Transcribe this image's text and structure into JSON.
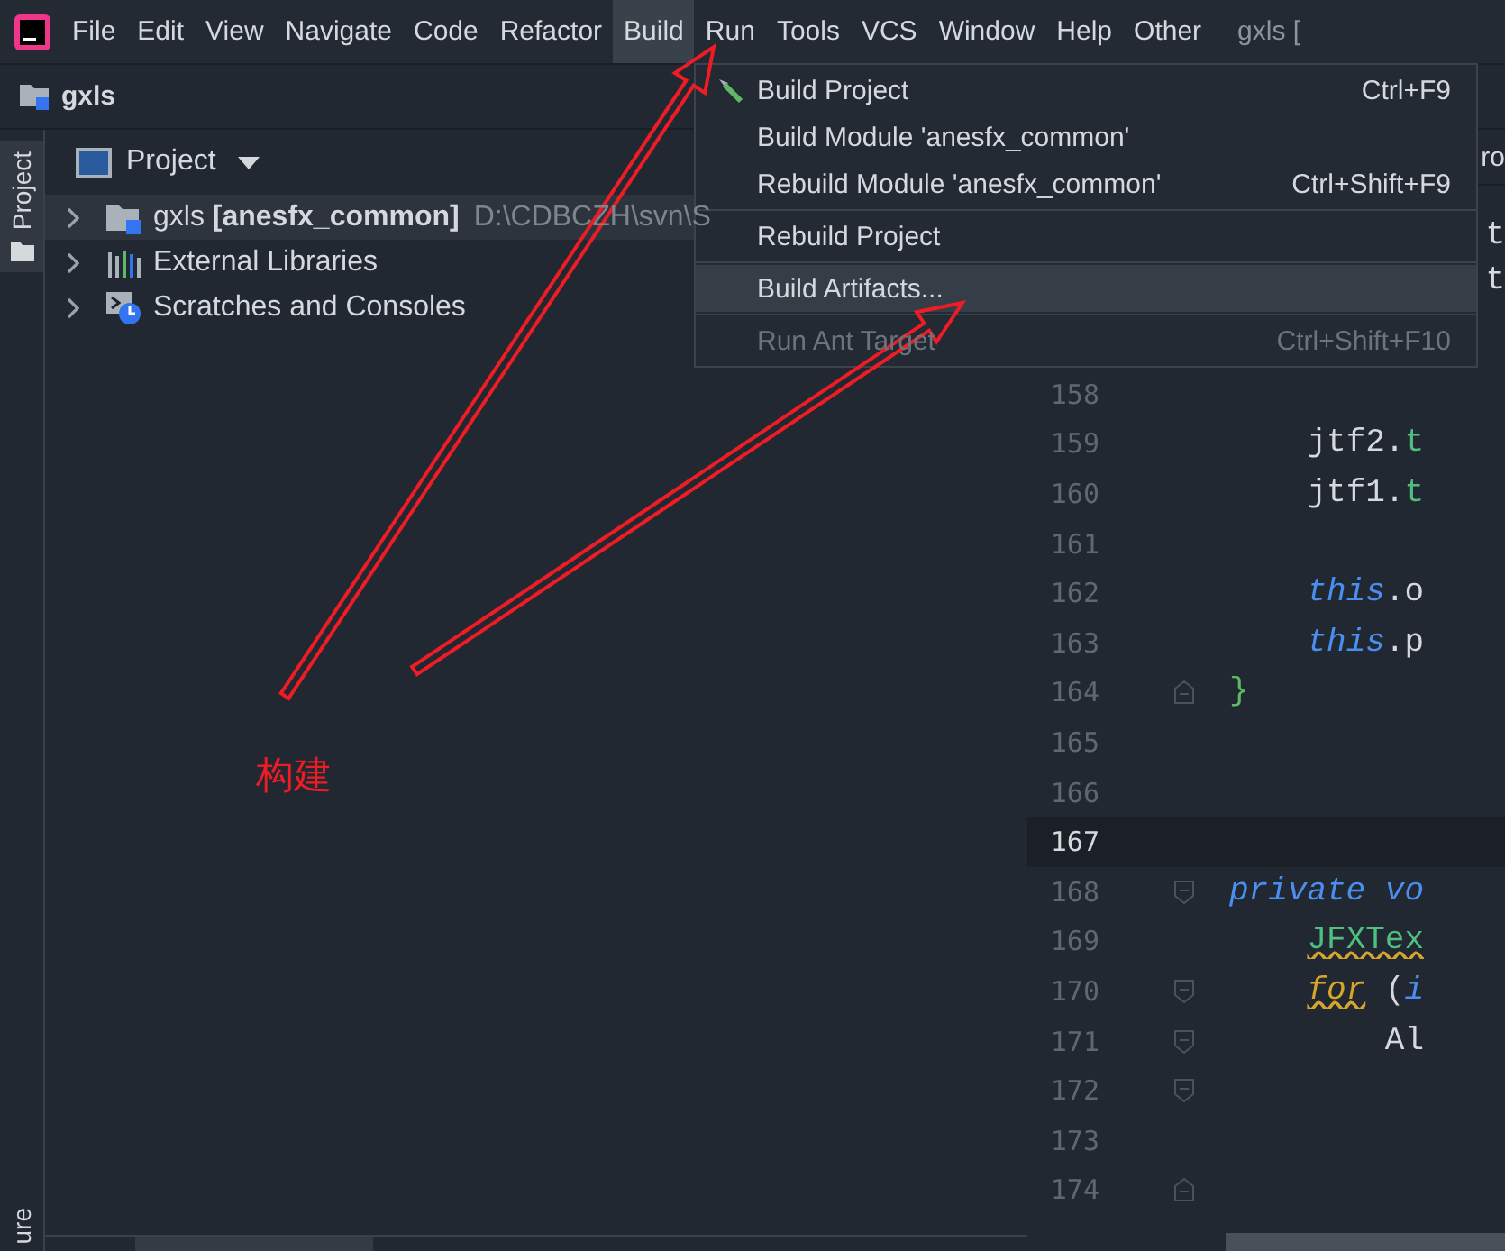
{
  "menu_bar": {
    "items": [
      {
        "label": "File",
        "selected": false
      },
      {
        "label": "Edit",
        "selected": false
      },
      {
        "label": "View",
        "selected": false
      },
      {
        "label": "Navigate",
        "selected": false
      },
      {
        "label": "Code",
        "selected": false
      },
      {
        "label": "Refactor",
        "selected": false
      },
      {
        "label": "Build",
        "selected": true
      },
      {
        "label": "Run",
        "selected": false
      },
      {
        "label": "Tools",
        "selected": false
      },
      {
        "label": "VCS",
        "selected": false
      },
      {
        "label": "Window",
        "selected": false
      },
      {
        "label": "Help",
        "selected": false
      },
      {
        "label": "Other",
        "selected": false
      }
    ],
    "window_title": "gxls ["
  },
  "navigation_bar": {
    "project": "gxls"
  },
  "left_strip": {
    "tabs": [
      {
        "label": "Project",
        "selected": true
      }
    ],
    "bottom_tab": "ure"
  },
  "project_panel": {
    "view": "Project",
    "tree": [
      {
        "kind": "module",
        "name": "gxls **[anesfx_common]**",
        "path": "D:\\CDBCZH\\svn\\S",
        "selected": true
      },
      {
        "kind": "libraries",
        "name": "External Libraries",
        "selected": false
      },
      {
        "kind": "scratches",
        "name": "Scratches and Consoles",
        "selected": false
      }
    ]
  },
  "build_menu": {
    "items": [
      {
        "label": "Build Project",
        "shortcut": "Ctrl+F9",
        "selected": false,
        "disabled": false
      },
      {
        "label": "Build Module 'anesfx_common'",
        "selected": false,
        "disabled": false
      },
      {
        "label": "Rebuild Module 'anesfx_common'",
        "shortcut": "Ctrl+Shift+F9",
        "selected": false,
        "disabled": false
      },
      {
        "label": "Rebuild Project",
        "selected": false,
        "disabled": false,
        "separator_before": true
      },
      {
        "label": "Build Artifacts...",
        "selected": true,
        "disabled": false,
        "separator_before": true
      },
      {
        "label": "Run Ant Target",
        "shortcut": "Ctrl+Shift+F10",
        "selected": false,
        "disabled": true,
        "separator_before": true
      }
    ]
  },
  "editor": {
    "tab": "ro",
    "hidden_lines": [
      [
        {
          "text": "t",
          "kind": "plain"
        }
      ],
      [
        {
          "text": "t",
          "kind": "plain"
        }
      ]
    ],
    "lines": [
      {
        "number": "158",
        "current": false,
        "kind": "plain"
      },
      {
        "number": "159",
        "current": false,
        "kind": "plain",
        "segments": [
          {
            "text": "    jtf2.",
            "kind": "plain"
          },
          {
            "text": "t",
            "kind": "member"
          }
        ]
      },
      {
        "number": "160",
        "current": false,
        "kind": "plain",
        "segments": [
          {
            "text": "    jtf1.",
            "kind": "plain"
          },
          {
            "text": "t",
            "kind": "member"
          }
        ]
      },
      {
        "number": "161",
        "current": false,
        "kind": "plain"
      },
      {
        "number": "162",
        "current": false,
        "kind": "plain",
        "segments": [
          {
            "text": "    this",
            "kind": "keyword"
          },
          {
            "text": ".o",
            "kind": "plain"
          }
        ]
      },
      {
        "number": "163",
        "current": false,
        "kind": "plain",
        "segments": [
          {
            "text": "    this",
            "kind": "keyword"
          },
          {
            "text": ".p",
            "kind": "plain"
          }
        ]
      },
      {
        "number": "164",
        "current": false,
        "kind": "fold-end",
        "segments": [
          {
            "text": "}",
            "kind": "brace"
          }
        ]
      },
      {
        "number": "165",
        "current": false,
        "kind": "plain"
      },
      {
        "number": "166",
        "current": false,
        "kind": "plain"
      },
      {
        "number": "167",
        "current": true,
        "kind": "plain"
      },
      {
        "number": "168",
        "current": false,
        "kind": "fold-start",
        "segments": [
          {
            "text": "private vo",
            "kind": "keyword"
          }
        ]
      },
      {
        "number": "169",
        "current": false,
        "kind": "plain",
        "segments": [
          {
            "text": "    JFXTex",
            "kind": "type-warning"
          }
        ]
      },
      {
        "number": "170",
        "current": false,
        "kind": "fold-start",
        "segments": [
          {
            "text": "    for",
            "kind": "keyword-warning"
          },
          {
            "text": " (",
            "kind": "plain"
          },
          {
            "text": "i",
            "kind": "keyword"
          }
        ]
      },
      {
        "number": "171",
        "current": false,
        "kind": "fold-start",
        "segments": [
          {
            "text": "        Al",
            "kind": "plain"
          }
        ]
      },
      {
        "number": "172",
        "current": false,
        "kind": "fold-start"
      },
      {
        "number": "173",
        "current": false,
        "kind": "plain"
      },
      {
        "number": "174",
        "current": false,
        "kind": "fold-end"
      }
    ]
  },
  "annotation": {
    "label": "构建"
  }
}
